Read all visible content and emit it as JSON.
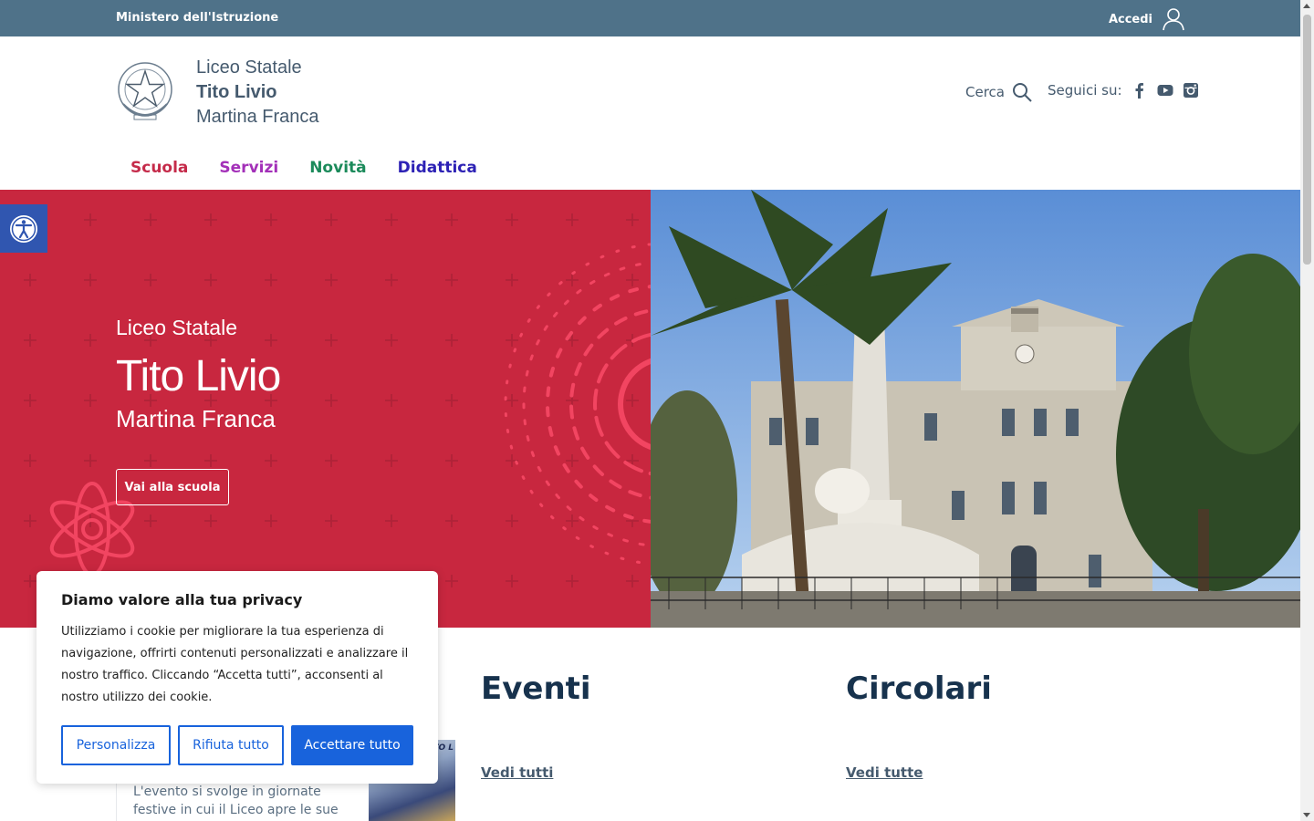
{
  "topbar": {
    "ministry": "Ministero dell'Istruzione",
    "login_label": "Accedi"
  },
  "header": {
    "name_line1": "Liceo Statale",
    "name_line2": "Tito Livio",
    "name_line3": "Martina Franca",
    "search_label": "Cerca",
    "follow_label": "Seguici su:"
  },
  "nav": {
    "items": [
      "Scuola",
      "Servizi",
      "Novità",
      "Didattica"
    ]
  },
  "hero": {
    "line1": "Liceo Statale",
    "line2": "Tito Livio",
    "line3": "Martina Franca",
    "button_label": "Vai alla scuola",
    "accent": "#c8273f"
  },
  "sections": {
    "events_title": "Eventi",
    "events_link": "Vedi tutti",
    "circolari_title": "Circolari",
    "circolari_link": "Vedi tutte",
    "card_text": "L'evento si svolge in giornate festive in cui il Liceo apre le sue porte e accoglie",
    "card_image_label": "TITO L"
  },
  "cookie": {
    "title": "Diamo valore alla tua privacy",
    "text": "Utilizziamo i cookie per migliorare la tua esperienza di navigazione, offrirti contenuti personalizzati e analizzare il nostro traffico. Cliccando “Accetta tutti”, acconsenti al nostro utilizzo dei cookie.",
    "customize": "Personalizza",
    "reject": "Rifiuta tutto",
    "accept": "Accettare tutto",
    "accent": "#1863dc"
  },
  "icons": [
    "user-icon",
    "search-icon",
    "facebook-icon",
    "youtube-icon",
    "instagram-icon",
    "accessibility-icon"
  ]
}
